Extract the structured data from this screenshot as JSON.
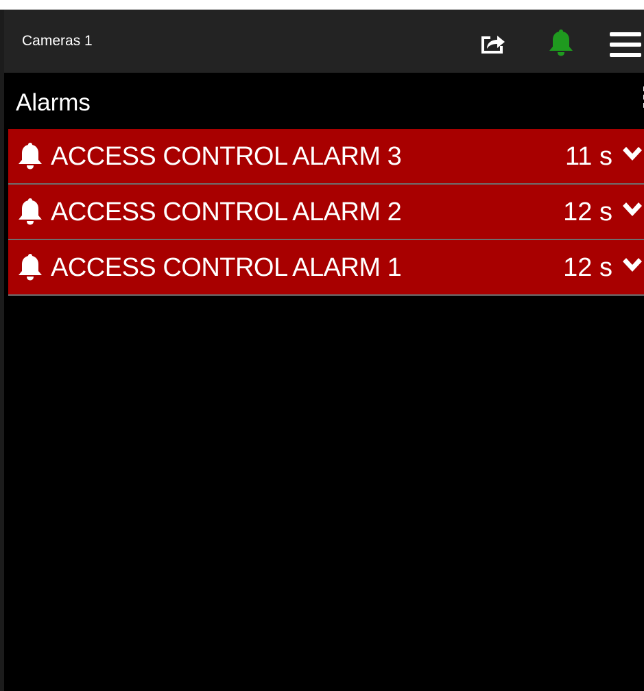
{
  "header": {
    "title": "Cameras 1",
    "icons": [
      "share-icon",
      "bell-icon",
      "hamburger-menu-icon"
    ]
  },
  "alarms_panel": {
    "title": "Alarms",
    "options_icon": "more-options-icon",
    "items": [
      {
        "label": "ACCESS CONTROL ALARM 3",
        "elapsed": "11 s"
      },
      {
        "label": "ACCESS CONTROL ALARM 2",
        "elapsed": "12 s"
      },
      {
        "label": "ACCESS CONTROL ALARM 1",
        "elapsed": "12 s"
      }
    ]
  },
  "colors": {
    "background": "#000000",
    "header_background": "#232323",
    "alarm_row": "#a80000",
    "notification_bell": "#1f9a1f",
    "text": "#ffffff"
  }
}
